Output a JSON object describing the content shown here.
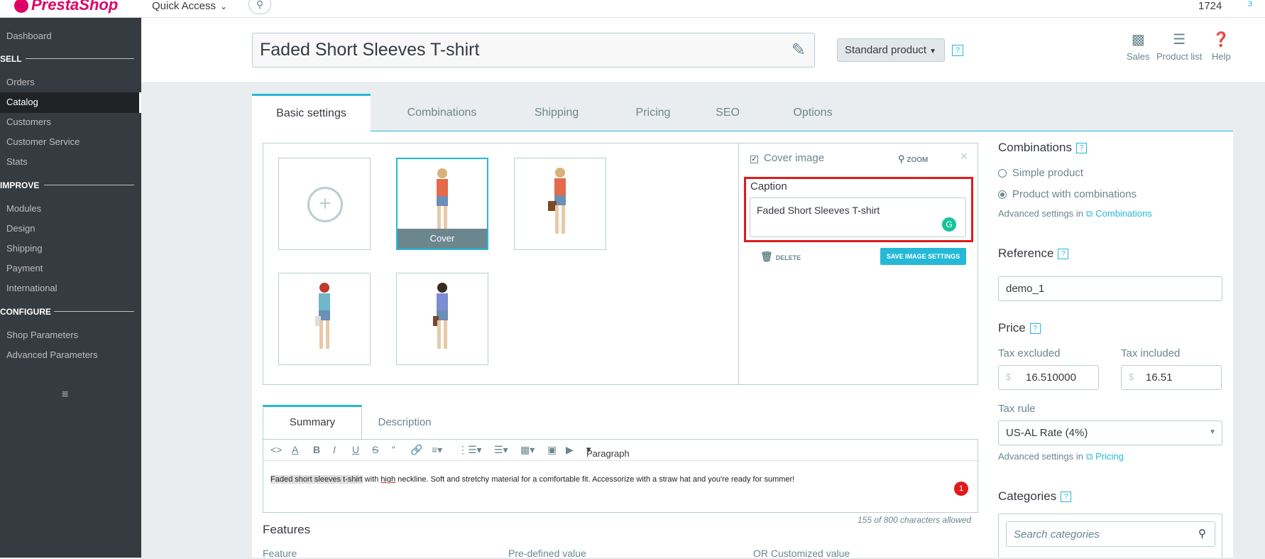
{
  "topbar": {
    "logo": "PrestaShop",
    "quick_access": "Quick Access",
    "number": "1724",
    "broken_img_alt": "3"
  },
  "sidebar": {
    "items": [
      {
        "label": "Dashboard"
      },
      {
        "section": "SELL"
      },
      {
        "label": "Orders"
      },
      {
        "label": "Catalog"
      },
      {
        "label": "Customers"
      },
      {
        "label": "Customer Service"
      },
      {
        "label": "Stats"
      },
      {
        "section": "IMPROVE"
      },
      {
        "label": "Modules"
      },
      {
        "label": "Design"
      },
      {
        "label": "Shipping"
      },
      {
        "label": "Payment"
      },
      {
        "label": "International"
      },
      {
        "section": "CONFIGURE"
      },
      {
        "label": "Shop Parameters"
      },
      {
        "label": "Advanced Parameters"
      }
    ]
  },
  "header": {
    "product_name": "Faded Short Sleeves T-shirt",
    "product_type": "Standard product",
    "help": "?",
    "buttons": [
      {
        "label": "Sales"
      },
      {
        "label": "Product list"
      },
      {
        "label": "Help"
      }
    ]
  },
  "tabs": [
    {
      "label": "Basic settings"
    },
    {
      "label": "Combinations"
    },
    {
      "label": "Shipping"
    },
    {
      "label": "Pricing"
    },
    {
      "label": "SEO"
    },
    {
      "label": "Options"
    }
  ],
  "images": {
    "cover_label": "Cover",
    "cover_image_checkbox": "Cover image",
    "zoom": "ZOOM",
    "caption_label": "Caption",
    "caption_value": "Faded Short Sleeves T-shirt",
    "delete": "DELETE",
    "save": "SAVE IMAGE SETTINGS"
  },
  "summary": {
    "tabs": [
      {
        "label": "Summary"
      },
      {
        "label": "Description"
      }
    ],
    "paragraph": "Paragraph",
    "text_highlight": "Faded short sleeves t-shirt",
    "text_mid": " with ",
    "text_underlined": "high",
    "text_rest": " neckline. Soft and stretchy material for a comfortable fit. Accessorize with a straw hat and you're ready for summer!",
    "badge": "1",
    "char_count": "155 of 800 characters allowed"
  },
  "features": {
    "title": "Features",
    "columns": [
      "Feature",
      "Pre-defined value",
      "OR Customized value"
    ]
  },
  "right": {
    "combinations_title": "Combinations",
    "simple_product": "Simple product",
    "product_with_combinations": "Product with combinations",
    "advanced_settings_in": "Advanced settings in",
    "combinations_link": "Combinations",
    "reference_title": "Reference",
    "reference_value": "demo_1",
    "price_title": "Price",
    "tax_excluded": "Tax excluded",
    "tax_included": "Tax included",
    "currency": "$",
    "price_excl": "16.510000",
    "price_incl": "16.51",
    "tax_rule_label": "Tax rule",
    "tax_rule_value": "US-AL Rate (4%)",
    "pricing_link": "Pricing",
    "categories_title": "Categories",
    "search_categories": "Search categories"
  },
  "colors": {
    "accent": "#25b9d7",
    "brand": "#df0067",
    "sidebar": "#363a41",
    "highlight_border": "#e01b1b"
  }
}
